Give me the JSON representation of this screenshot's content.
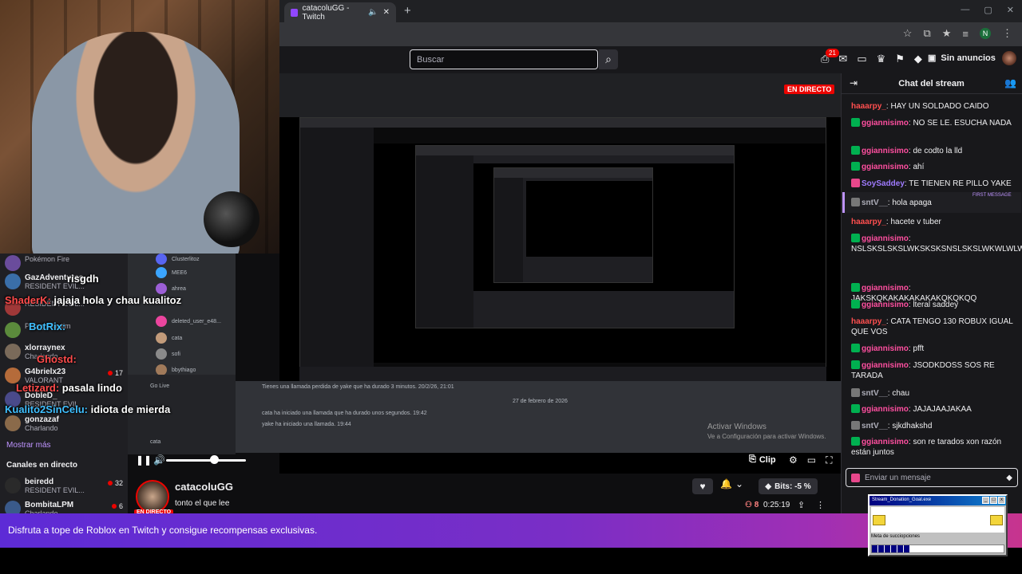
{
  "browser": {
    "tab_title": "catacoluGG - Twitch",
    "new_tab": "+",
    "profile_initial": "N"
  },
  "nav": {
    "search_placeholder": "Buscar",
    "notification_count": "21",
    "no_ads_label": "Sin anuncios"
  },
  "player": {
    "live_badge": "EN DIRECTO",
    "activate_windows_title": "Activar Windows",
    "activate_windows_sub": "Ve a Configuración para activar Windows.",
    "clip_label": "Clip",
    "volume_percent": 60
  },
  "overlay_chat": [
    {
      "user": "",
      "text": "risgdh"
    },
    {
      "user": "ShaderK:",
      "text": "jajaja hola y chau kualitoz"
    },
    {
      "user": "BotRix:",
      "text": ""
    },
    {
      "user": "Ghostd:",
      "text": ""
    },
    {
      "user": "Letizard:",
      "text": "pasala lindo"
    },
    {
      "user": "Kualito2SinCelu:",
      "text": "idiota de mierda"
    }
  ],
  "left_sidebar": {
    "followed": [
      {
        "name": "",
        "game": "Pokémon Fire",
        "viewers": ""
      },
      {
        "name": "GazAdventures",
        "game": "RESIDENT EVIL...",
        "viewers": ""
      },
      {
        "name": "",
        "game": "RESIDENT EVIL...",
        "viewers": ""
      },
      {
        "name": "",
        "game": "Poppy Playtim",
        "viewers": ""
      },
      {
        "name": "xlorraynex",
        "game": "Charlando",
        "viewers": ""
      },
      {
        "name": "G4brielx23",
        "game": "VALORANT",
        "viewers": "17"
      },
      {
        "name": "DobleD_",
        "game": "RESIDENT EVIL",
        "viewers": ""
      },
      {
        "name": "gonzazaf",
        "game": "Charlando",
        "viewers": ""
      }
    ],
    "show_more": "Mostrar más",
    "live_channels_header": "Canales en directo",
    "live_channels": [
      {
        "name": "beiredd",
        "game": "RESIDENT EVIL...",
        "viewers": "32"
      },
      {
        "name": "BombitaLPM",
        "game": "Charlando",
        "viewers": "6"
      }
    ]
  },
  "discord_mini": {
    "users": [
      "Clusterlitoz",
      "MEE6",
      "ahrea",
      "deleted_user_e48...",
      "cata",
      "sofi",
      "bbythiago"
    ],
    "go_live": "Go Live",
    "self_name": "cata"
  },
  "stream_chat_log": {
    "missed_call": "Tienes una llamada perdida de yake que ha durado 3 minutos. 20/2/26, 21:01",
    "date": "27 de febrero de 2026",
    "line1": "cata ha iniciado una llamada que ha durado unos segundos. 19:42",
    "line2": "yake ha iniciado una llamada. 19:44"
  },
  "stream_info": {
    "channel_name": "catacoluGG",
    "title": "tonto el que lee",
    "live_tag": "EN DIRECTO",
    "bits_label": "Bits: -5 %",
    "viewers": "8",
    "uptime": "0:25:19"
  },
  "chat": {
    "header": "Chat del stream",
    "first_message_label": "FIRST MESSAGE",
    "input_placeholder": "Enviar un mensaje",
    "messages": [
      {
        "user": "haaarpy_",
        "text": ": HAY UN SOLDADO CAIDO",
        "color": "#ff4f4f"
      },
      {
        "user": "ggiannisimo",
        "text": ": NO SE LE. ESUCHA NADA",
        "color": "#ff4fa0"
      },
      {
        "user": "ggiannisimo",
        "text": ": de codto la lld",
        "color": "#ff4fa0"
      },
      {
        "user": "ggiannisimo",
        "text": ": ahí",
        "color": "#ff4fa0"
      },
      {
        "user": "SoySaddey",
        "text": ": TE TIENEN RE PILLO YAKE",
        "color": "#9f7bff"
      },
      {
        "user": "sntV__",
        "text": ": hola apaga",
        "color": "#adadb8"
      },
      {
        "user": "haaarpy_",
        "text": ": hacete v tuber",
        "color": "#ff4f4f"
      },
      {
        "user": "ggiannisimo",
        "text": ": NSLSKSLSKSLWKSKSKSNSLSKSLWKWLWLWLWW",
        "color": "#ff4fa0"
      },
      {
        "user": "ggiannisimo",
        "text": ": JAKSKQKAKAKAKAKAKQKQKQQ",
        "color": "#ff4fa0"
      },
      {
        "user": "ggiannisimo",
        "text": ": lteral saddey",
        "color": "#ff4fa0"
      },
      {
        "user": "haaarpy_",
        "text": ": CATA TENGO 130 ROBUX IGUAL QUE VOS",
        "color": "#ff4f4f"
      },
      {
        "user": "ggiannisimo",
        "text": ": pfft",
        "color": "#ff4fa0"
      },
      {
        "user": "ggiannisimo",
        "text": ": JSODKDOSS SOS RE TARADA",
        "color": "#ff4fa0"
      },
      {
        "user": "sntV__",
        "text": ": chau",
        "color": "#adadb8"
      },
      {
        "user": "ggiannisimo",
        "text": ": JAJAJAAJAKAA",
        "color": "#ff4fa0"
      },
      {
        "user": "sntV__",
        "text": ": sjkdhakshd",
        "color": "#adadb8"
      },
      {
        "user": "ggiannisimo",
        "text": ": son re tarados xon razón están juntos",
        "color": "#ff4fa0"
      }
    ]
  },
  "banner": {
    "text": "Disfruta a tope de Roblox en Twitch y consigue recompensas exclusivas."
  },
  "donation_goal": {
    "title": "Stream_Donation_Goal.exe",
    "label": "Meta de succiopciones",
    "progress": 0.29
  },
  "colors": {
    "twitch_purple": "#9147ff",
    "live_red": "#eb0400",
    "chat_bg": "#18181b"
  }
}
